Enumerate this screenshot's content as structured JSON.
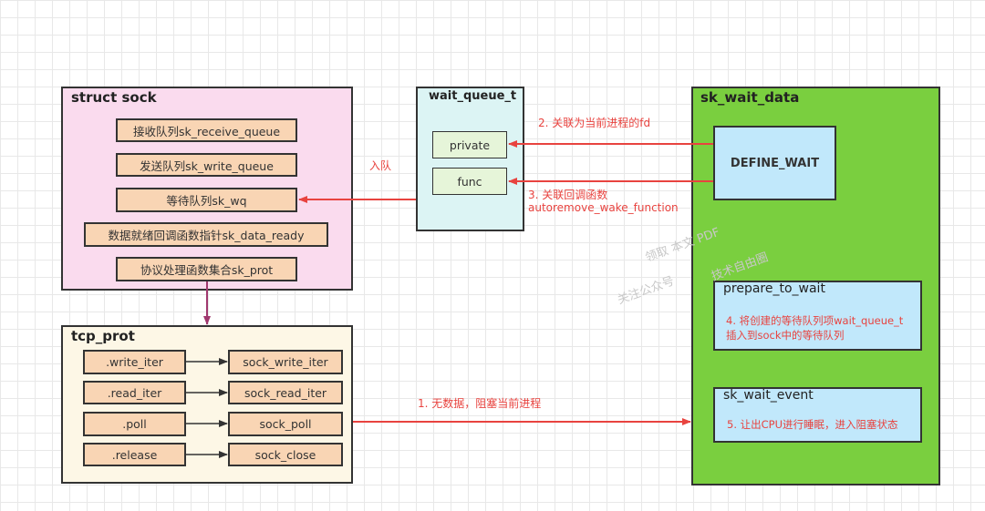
{
  "struct_sock": {
    "title": "struct sock",
    "items": [
      "接收队列sk_receive_queue",
      "发送队列sk_write_queue",
      "等待队列sk_wq",
      "数据就绪回调函数指针sk_data_ready",
      "协议处理函数集合sk_prot"
    ]
  },
  "wait_queue": {
    "title": "wait_queue_t",
    "items": [
      "private",
      "func"
    ]
  },
  "sk_wait_data": {
    "title": "sk_wait_data",
    "define_wait": "DEFINE_WAIT",
    "prepare": {
      "title": "prepare_to_wait",
      "note": "4. 将创建的等待队列项wait_queue_t\n插入到sock中的等待队列"
    },
    "wait_event": {
      "title": "sk_wait_event",
      "note": "5. 让出CPU进行睡眠，进入阻塞状态"
    }
  },
  "tcp_prot": {
    "title": "tcp_prot",
    "rows": [
      {
        "left": ".write_iter",
        "right": "sock_write_iter"
      },
      {
        "left": ".read_iter",
        "right": "sock_read_iter"
      },
      {
        "left": ".poll",
        "right": "sock_poll"
      },
      {
        "left": ".release",
        "right": "sock_close"
      }
    ]
  },
  "labels": {
    "enqueue": "入队",
    "step2": "2. 关联为当前进程的fd",
    "step3a": "3. 关联回调函数",
    "step3b": "autoremove_wake_function",
    "step1": "1. 无数据，阻塞当前进程"
  },
  "watermark": [
    "领取 本文 PDF",
    "关注公众号",
    "技术自由圈"
  ],
  "colors": {
    "sock": "#fadbee",
    "item": "#f9d5b4",
    "wait_queue": "#dcf4f4",
    "wq_item": "#e6f5d9",
    "green": "#7acf3f",
    "blue": "#c1e8fb",
    "tcp": "#fdf7e6",
    "arrow": "#e8433f",
    "link": "#a0386e"
  }
}
